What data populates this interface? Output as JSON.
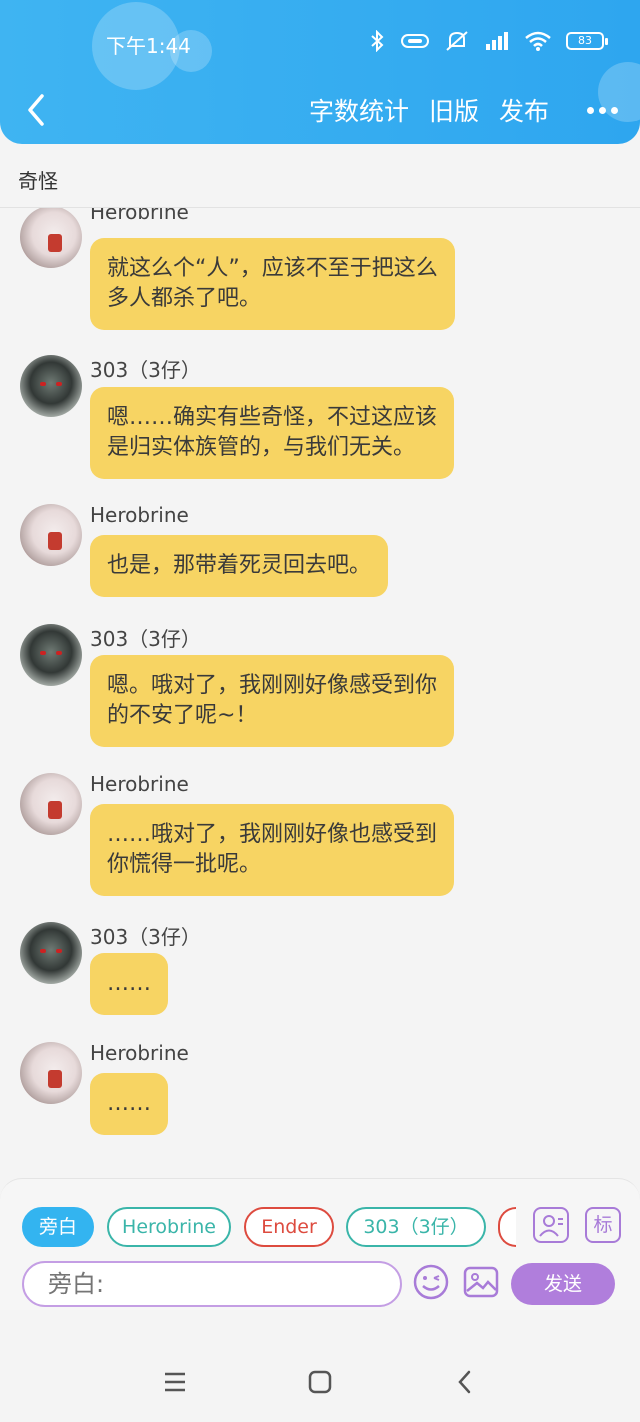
{
  "status_bar": {
    "time": "下午1:44",
    "battery": "83"
  },
  "header": {
    "actions": [
      "字数统计",
      "旧版",
      "发布"
    ]
  },
  "chat": {
    "title": "奇怪"
  },
  "messages": [
    {
      "sender": "Herobrine",
      "avatar": "herobrine-avatar",
      "text_lines": [
        "就这么个“人”，应该不至于把这么",
        "多人都杀了吧。"
      ]
    },
    {
      "sender": "303（3仔）",
      "avatar": "303-avatar",
      "text_lines": [
        "嗯……确实有些奇怪，不过这应该",
        "是归实体族管的，与我们无关。"
      ]
    },
    {
      "sender": "Herobrine",
      "avatar": "herobrine-avatar",
      "text_lines": [
        "也是，那带着死灵回去吧。"
      ]
    },
    {
      "sender": "303（3仔）",
      "avatar": "303-avatar",
      "text_lines": [
        "嗯。哦对了，我刚刚好像感受到你",
        "的不安了呢~！"
      ]
    },
    {
      "sender": "Herobrine",
      "avatar": "herobrine-avatar",
      "text_lines": [
        "……哦对了，我刚刚好像也感受到",
        "你慌得一批呢。"
      ]
    },
    {
      "sender": "303（3仔）",
      "avatar": "303-avatar",
      "text_lines": [
        "……"
      ]
    },
    {
      "sender": "Herobrine",
      "avatar": "herobrine-avatar",
      "text_lines": [
        "……"
      ]
    }
  ],
  "input": {
    "roles": [
      "旁白",
      "Herobrine",
      "Ender",
      "303（3仔）"
    ],
    "mark_label": "标",
    "placeholder": "旁白:",
    "send_label": "发送"
  },
  "colors": {
    "header": "#2ea6ef",
    "bubble": "#f7d463",
    "accent_purple": "#b07edc"
  }
}
